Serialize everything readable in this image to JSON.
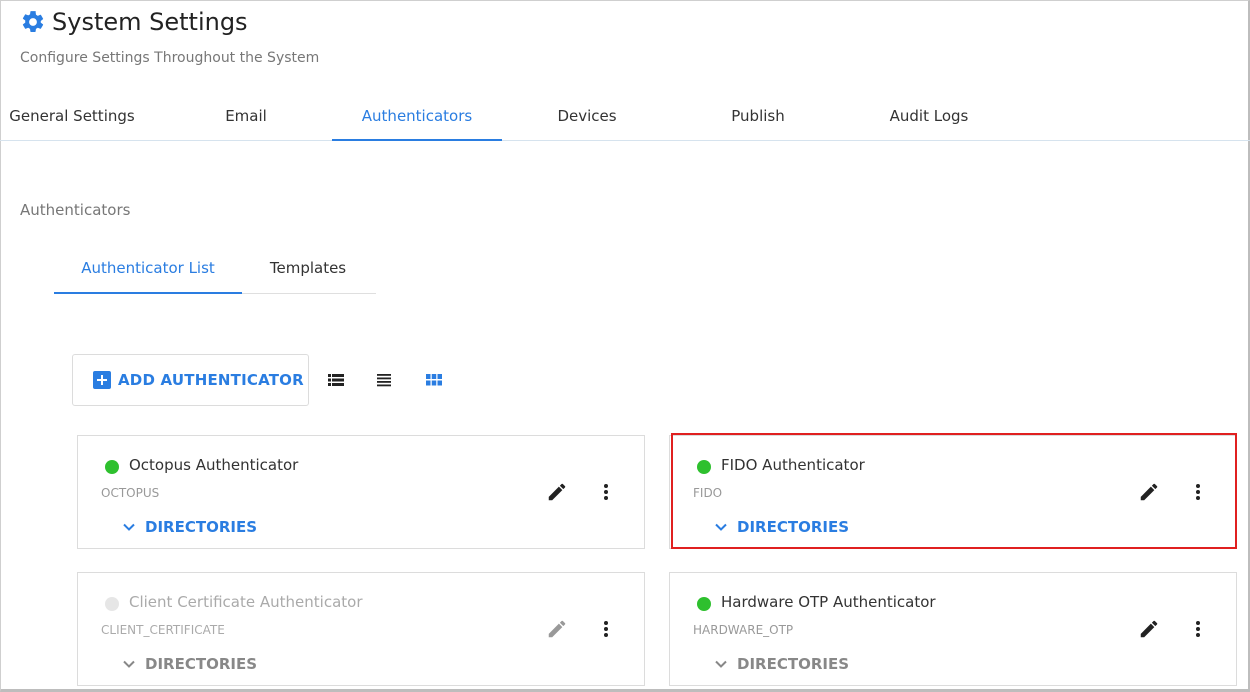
{
  "header": {
    "title": "System Settings",
    "subtitle": "Configure Settings Throughout the System"
  },
  "main_tabs": [
    {
      "label": "General Settings"
    },
    {
      "label": "Email"
    },
    {
      "label": "Authenticators"
    },
    {
      "label": "Devices"
    },
    {
      "label": "Publish"
    },
    {
      "label": "Audit Logs"
    }
  ],
  "active_main_tab": "Authenticators",
  "section": {
    "label": "Authenticators"
  },
  "sub_tabs": [
    {
      "label": "Authenticator List"
    },
    {
      "label": "Templates"
    }
  ],
  "active_sub_tab": "Authenticator List",
  "toolbar": {
    "add_label": "ADD AUTHENTICATOR",
    "view_icons": [
      "list-detail-icon",
      "list-icon",
      "grid-icon"
    ],
    "active_view": "grid-icon"
  },
  "cards": [
    {
      "name": "Octopus Authenticator",
      "code": "OCTOPUS",
      "directories_label": "DIRECTORIES",
      "enabled": true
    },
    {
      "name": "FIDO Authenticator",
      "code": "FIDO",
      "directories_label": "DIRECTORIES",
      "enabled": true,
      "highlighted": true
    },
    {
      "name": "Client Certificate Authenticator",
      "code": "CLIENT_CERTIFICATE",
      "directories_label": "DIRECTORIES",
      "enabled": false
    },
    {
      "name": "Hardware OTP Authenticator",
      "code": "HARDWARE_OTP",
      "directories_label": "DIRECTORIES",
      "enabled": true
    }
  ],
  "colors": {
    "accent": "#2a7de1",
    "status_enabled": "#2ec02e",
    "status_disabled": "#e6e6e6",
    "highlight": "#e02020"
  }
}
